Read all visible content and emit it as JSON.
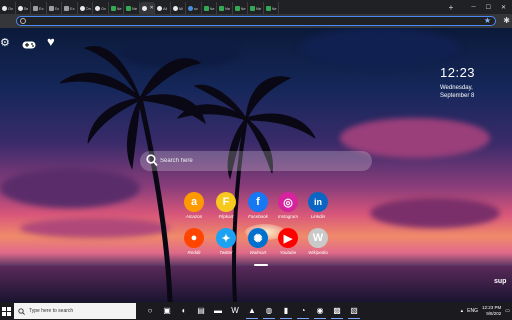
{
  "browser": {
    "tabs": [
      {
        "label": "On",
        "fav": "white"
      },
      {
        "label": "Se",
        "fav": "white"
      },
      {
        "label": "Ex",
        "fav": "puzzle"
      },
      {
        "label": "Ex",
        "fav": "puzzle"
      },
      {
        "label": "Ex",
        "fav": "puzzle"
      },
      {
        "label": "On",
        "fav": "white"
      },
      {
        "label": "On",
        "fav": "white"
      },
      {
        "label": "Ne",
        "fav": "green"
      },
      {
        "label": "Ne",
        "fav": "green"
      },
      {
        "label": "",
        "fav": "white",
        "active": true
      },
      {
        "label": "Ali",
        "fav": "white"
      },
      {
        "label": "Ali",
        "fav": "white"
      },
      {
        "label": "sc",
        "fav": "blue"
      },
      {
        "label": "Ne",
        "fav": "green"
      },
      {
        "label": "Ne",
        "fav": "green"
      },
      {
        "label": "Ne",
        "fav": "green"
      },
      {
        "label": "Ne",
        "fav": "green"
      },
      {
        "label": "Ne",
        "fav": "green"
      }
    ],
    "new_tab": "+",
    "window_controls": [
      "─",
      "☐",
      "✕"
    ],
    "url_value": "",
    "bookmark_star": "★",
    "extension_icon": "✱"
  },
  "newtab": {
    "clock": "12:23",
    "date_line1": "Wednesday,",
    "date_line2": "September 8",
    "search_placeholder": "Search here",
    "shortcuts": [
      {
        "label": "Amazon",
        "color": "#ff9900",
        "glyph": "a"
      },
      {
        "label": "Flipkart",
        "color": "#f7c81e",
        "glyph": "F"
      },
      {
        "label": "Facebook",
        "color": "#1877f2",
        "glyph": "f"
      },
      {
        "label": "Instagram",
        "color": "#d6249f",
        "glyph": "◎"
      },
      {
        "label": "Linkdin",
        "color": "#0a66c2",
        "glyph": "in"
      },
      {
        "label": "Reddit",
        "color": "#ff4500",
        "glyph": "●"
      },
      {
        "label": "Twitter",
        "color": "#1da1f2",
        "glyph": "✦"
      },
      {
        "label": "Walmart",
        "color": "#0071ce",
        "glyph": "✺"
      },
      {
        "label": "Youtube",
        "color": "#ff0000",
        "glyph": "▶"
      },
      {
        "label": "Wikipedia",
        "color": "#c9c9c9",
        "glyph": "W"
      }
    ],
    "watermark": "sup"
  },
  "taskbar": {
    "search_placeholder": "Type here to search",
    "apps": [
      {
        "name": "cortana",
        "glyph": "○"
      },
      {
        "name": "task-view",
        "glyph": "▣"
      },
      {
        "name": "edge",
        "glyph": "◐"
      },
      {
        "name": "store",
        "glyph": "▤"
      },
      {
        "name": "explorer",
        "glyph": "▬"
      },
      {
        "name": "office",
        "glyph": "W"
      },
      {
        "name": "photos",
        "glyph": "▲"
      },
      {
        "name": "whatsapp",
        "glyph": "◍"
      },
      {
        "name": "app-1",
        "glyph": "▮"
      },
      {
        "name": "edge-2",
        "glyph": "◔"
      },
      {
        "name": "chrome",
        "glyph": "◉"
      },
      {
        "name": "app-2",
        "glyph": "▩"
      },
      {
        "name": "app-3",
        "glyph": "▧"
      }
    ],
    "tray_lang": "ENG",
    "tray_time": "12:23 PM",
    "tray_date": "9/8/202"
  },
  "colors": {
    "accent": "#4a8af4",
    "taskbar": "#1b1b1f",
    "chrome_dark": "#202124"
  }
}
